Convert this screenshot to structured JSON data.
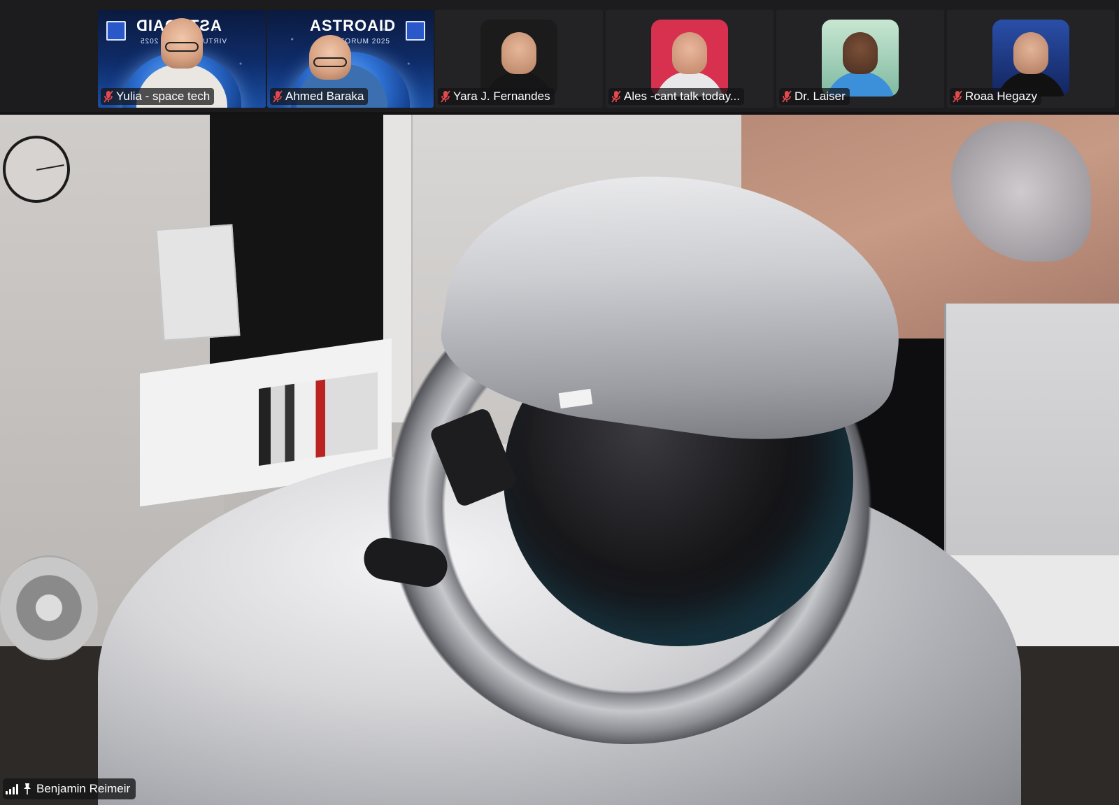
{
  "participants": [
    {
      "name": "Yulia - space tech",
      "muted": true,
      "tile": "video-banner-mirrored",
      "banner": "ASTROAID",
      "banner_sub": "VIRTUAL FORUM 2025"
    },
    {
      "name": "Ahmed Baraka",
      "muted": true,
      "tile": "video-banner",
      "banner": "ASTROAID",
      "banner_sub": "L FORUM 2025"
    },
    {
      "name": "Yara J. Fernandes",
      "muted": true,
      "tile": "avatar"
    },
    {
      "name": "Ales -cant talk today...",
      "muted": true,
      "tile": "avatar"
    },
    {
      "name": "Dr. Laiser",
      "muted": true,
      "tile": "avatar"
    },
    {
      "name": "Roaa Hegazy",
      "muted": true,
      "tile": "avatar"
    }
  ],
  "active_speaker": {
    "name": "Benjamin Reimeir",
    "pinned": true
  },
  "colors": {
    "background": "#1a1a1c",
    "mic_muted": "#e5484d",
    "label_bg": "#141416",
    "label_text": "#ffffff"
  },
  "icons": {
    "mic": "mic-off-icon",
    "signal": "signal-strength-icon",
    "pin": "pin-icon"
  }
}
